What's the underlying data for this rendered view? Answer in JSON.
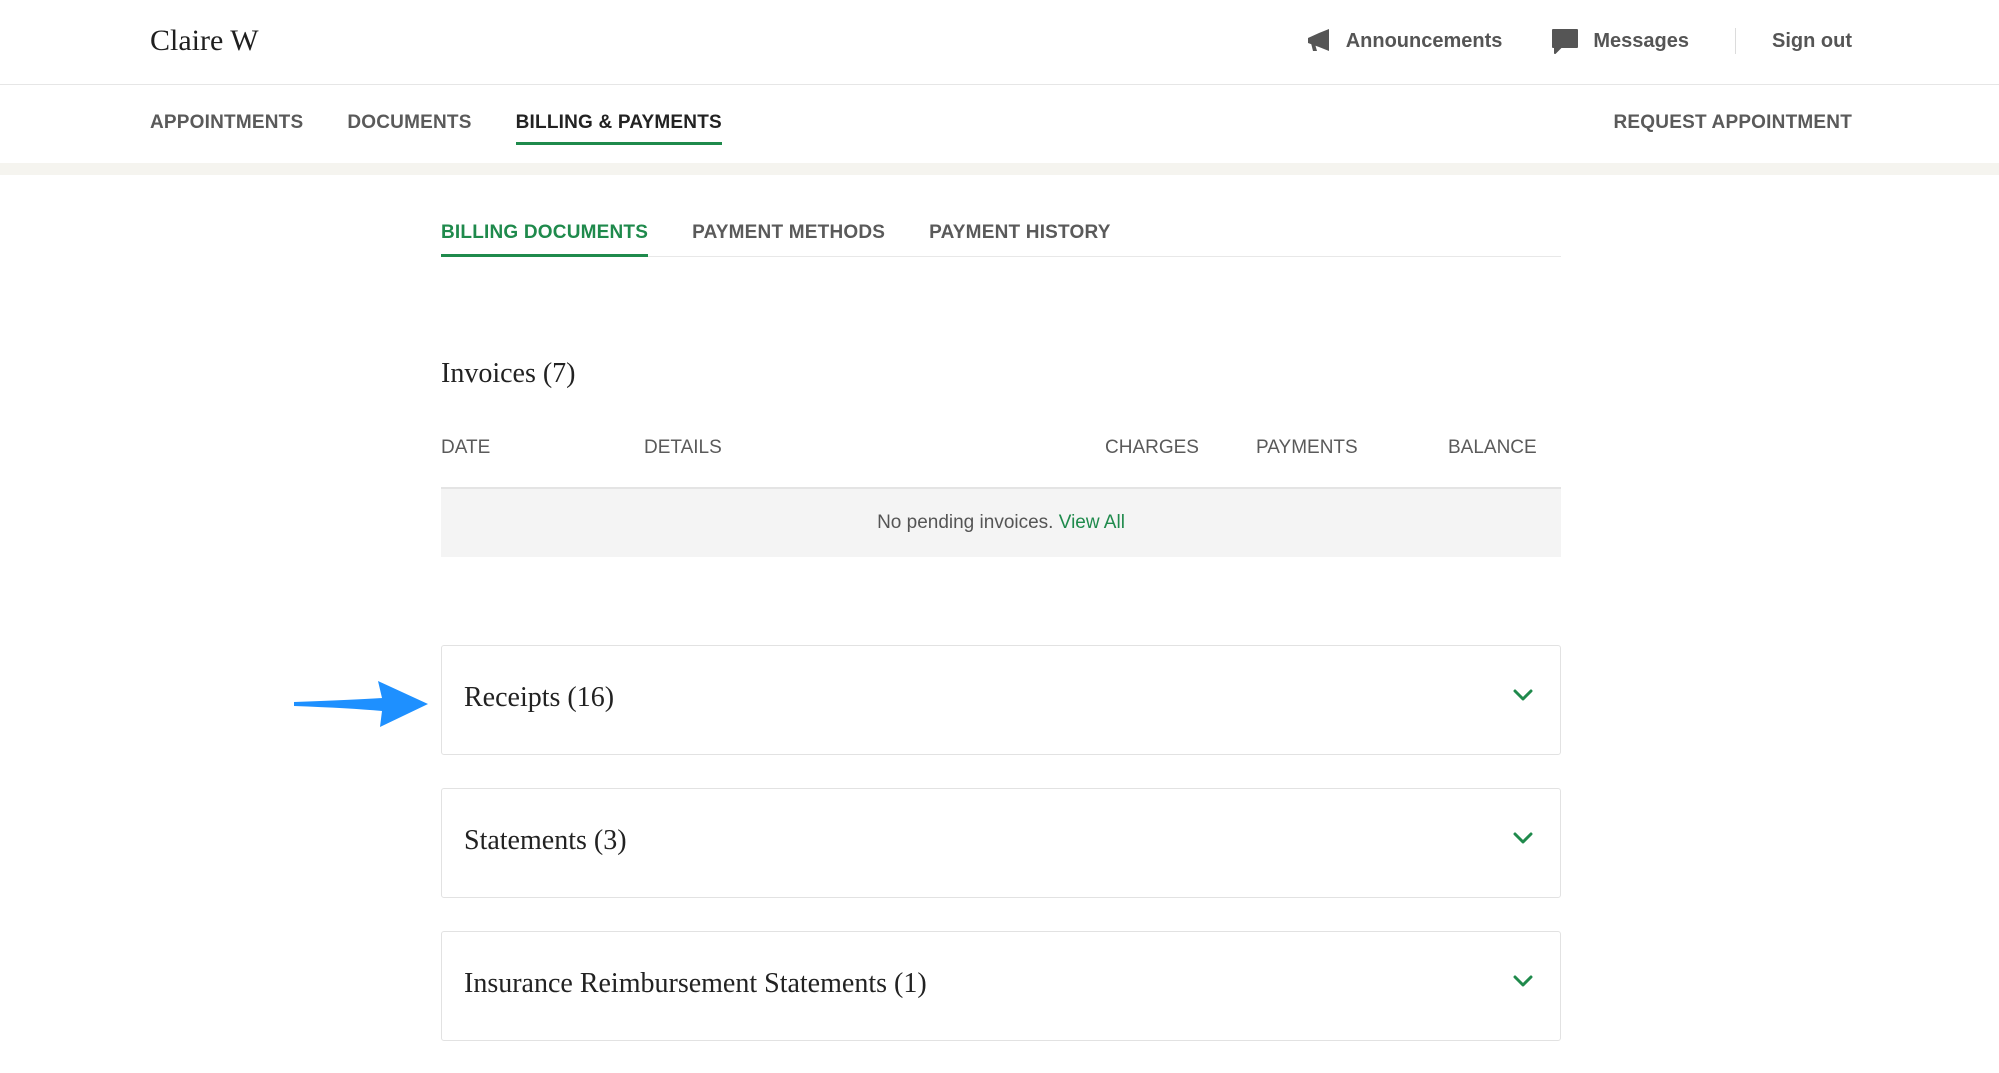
{
  "header": {
    "user_name": "Claire W",
    "announcements_label": "Announcements",
    "messages_label": "Messages",
    "signout_label": "Sign out"
  },
  "nav": {
    "items": [
      {
        "label": "APPOINTMENTS",
        "active": false
      },
      {
        "label": "DOCUMENTS",
        "active": false
      },
      {
        "label": "BILLING & PAYMENTS",
        "active": true
      }
    ],
    "request_label": "REQUEST APPOINTMENT"
  },
  "subtabs": [
    {
      "label": "BILLING DOCUMENTS",
      "active": true
    },
    {
      "label": "PAYMENT METHODS",
      "active": false
    },
    {
      "label": "PAYMENT HISTORY",
      "active": false
    }
  ],
  "invoices": {
    "title": "Invoices (7)",
    "columns": [
      "DATE",
      "DETAILS",
      "CHARGES",
      "PAYMENTS",
      "BALANCE"
    ],
    "empty_message": "No pending invoices.",
    "view_all_label": "View All"
  },
  "sections": [
    {
      "title": "Receipts (16)"
    },
    {
      "title": "Statements (3)"
    },
    {
      "title": "Insurance Reimbursement Statements (1)"
    }
  ],
  "colors": {
    "accent_green": "#1f8a4c",
    "arrow_blue": "#1e90ff",
    "nav_band": "#f5f4ef"
  },
  "icons": {
    "announcements": "megaphone-icon",
    "messages": "chat-bubble-icon",
    "accordion": "chevron-down-icon",
    "pointer": "arrow-right-icon"
  }
}
